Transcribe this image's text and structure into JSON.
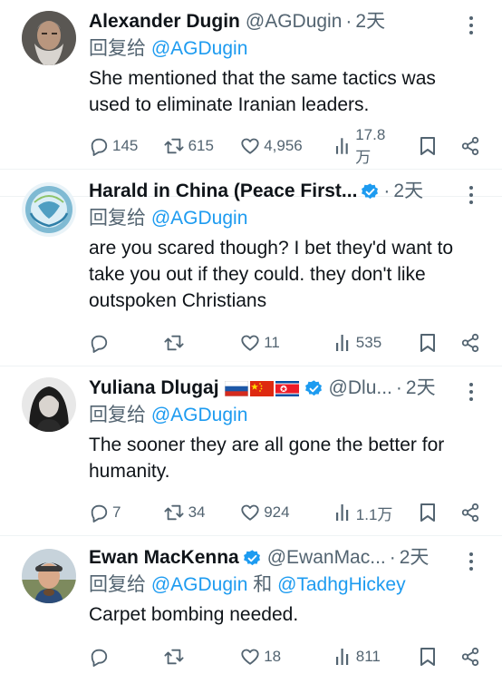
{
  "tweets": [
    {
      "name": "Alexander Dugin",
      "handle": "@AGDugin",
      "time": "2天",
      "reply_prefix": "回复给",
      "mentions": [
        "@AGDugin"
      ],
      "mention_joiner": "",
      "text": "She mentioned that the same tactics was used to eliminate Iranian leaders.",
      "counts": {
        "replies": "145",
        "retweets": "615",
        "likes": "4,956",
        "views": "17.8万"
      },
      "verified": false,
      "flags": []
    },
    {
      "name": "Harald in China (Peace First...",
      "handle": "",
      "time": "2天",
      "reply_prefix": "回复给",
      "mentions": [
        "@AGDugin"
      ],
      "mention_joiner": "",
      "text": "are you scared though? I bet they'd want to take you out if they could. they don't like outspoken Christians",
      "counts": {
        "replies": "",
        "retweets": "",
        "likes": "11",
        "views": "535"
      },
      "verified": true,
      "flags": []
    },
    {
      "name": "Yuliana Dlugaj",
      "handle": "@Dlu...",
      "time": "2天",
      "reply_prefix": "回复给",
      "mentions": [
        "@AGDugin"
      ],
      "mention_joiner": "",
      "text": "The sooner they are all gone the better for humanity.",
      "counts": {
        "replies": "7",
        "retweets": "34",
        "likes": "924",
        "views": "1.1万"
      },
      "verified": true,
      "flags": [
        "russia-flag",
        "china-flag",
        "north-korea-flag"
      ]
    },
    {
      "name": "Ewan MacKenna",
      "handle": "@EwanMac...",
      "time": "2天",
      "reply_prefix": "回复给",
      "mentions": [
        "@AGDugin",
        "@TadhgHickey"
      ],
      "mention_joiner": "和",
      "text": "Carpet bombing needed.",
      "counts": {
        "replies": "",
        "retweets": "",
        "likes": "18",
        "views": "811"
      },
      "verified": true,
      "flags": []
    }
  ],
  "icons": {
    "reply": "reply-icon",
    "retweet": "retweet-icon",
    "like": "heart-icon",
    "views": "views-icon",
    "bookmark": "bookmark-icon",
    "share": "share-icon",
    "more": "more-icon",
    "verified": "verified-badge-icon"
  },
  "colors": {
    "text": "#0f1419",
    "secondary": "#536471",
    "link": "#1d9bf0",
    "verified": "#1d9bf0",
    "divider": "#eff3f4"
  }
}
